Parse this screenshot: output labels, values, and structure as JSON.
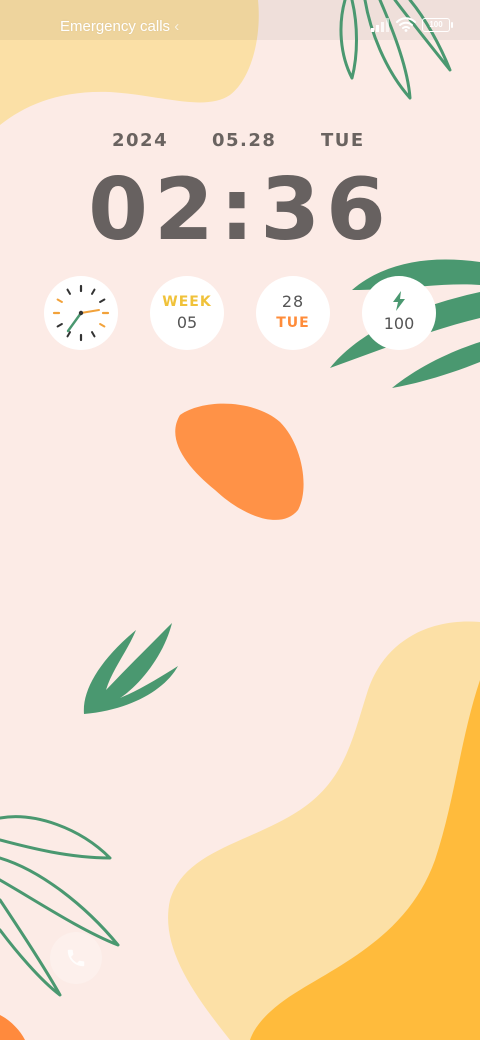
{
  "status_bar": {
    "carrier_text": "Emergency calls",
    "carrier_chevron": "‹",
    "battery_level": "100",
    "signal_icon": "signal-bars-icon",
    "wifi_icon": "wifi-icon"
  },
  "lock_screen": {
    "year": "2024",
    "month_day": "05.28",
    "weekday": "TUE",
    "time": "02:36"
  },
  "widgets": {
    "week": {
      "label": "WEEK",
      "value": "05"
    },
    "day": {
      "number": "28",
      "weekday": "TUE"
    },
    "battery": {
      "value": "100",
      "icon": "lightning-bolt-icon"
    },
    "clock": {
      "icon": "analog-clock-icon"
    }
  },
  "shortcuts": {
    "phone_icon": "phone-icon"
  },
  "colors": {
    "background": "#fcebe6",
    "light_yellow": "#fce1a8",
    "deep_yellow": "#ffbb3c",
    "orange": "#ff9045",
    "green": "#4a9870",
    "text_gray": "#676160",
    "week_yellow": "#f0c23a",
    "day_orange": "#ff8c3a"
  }
}
